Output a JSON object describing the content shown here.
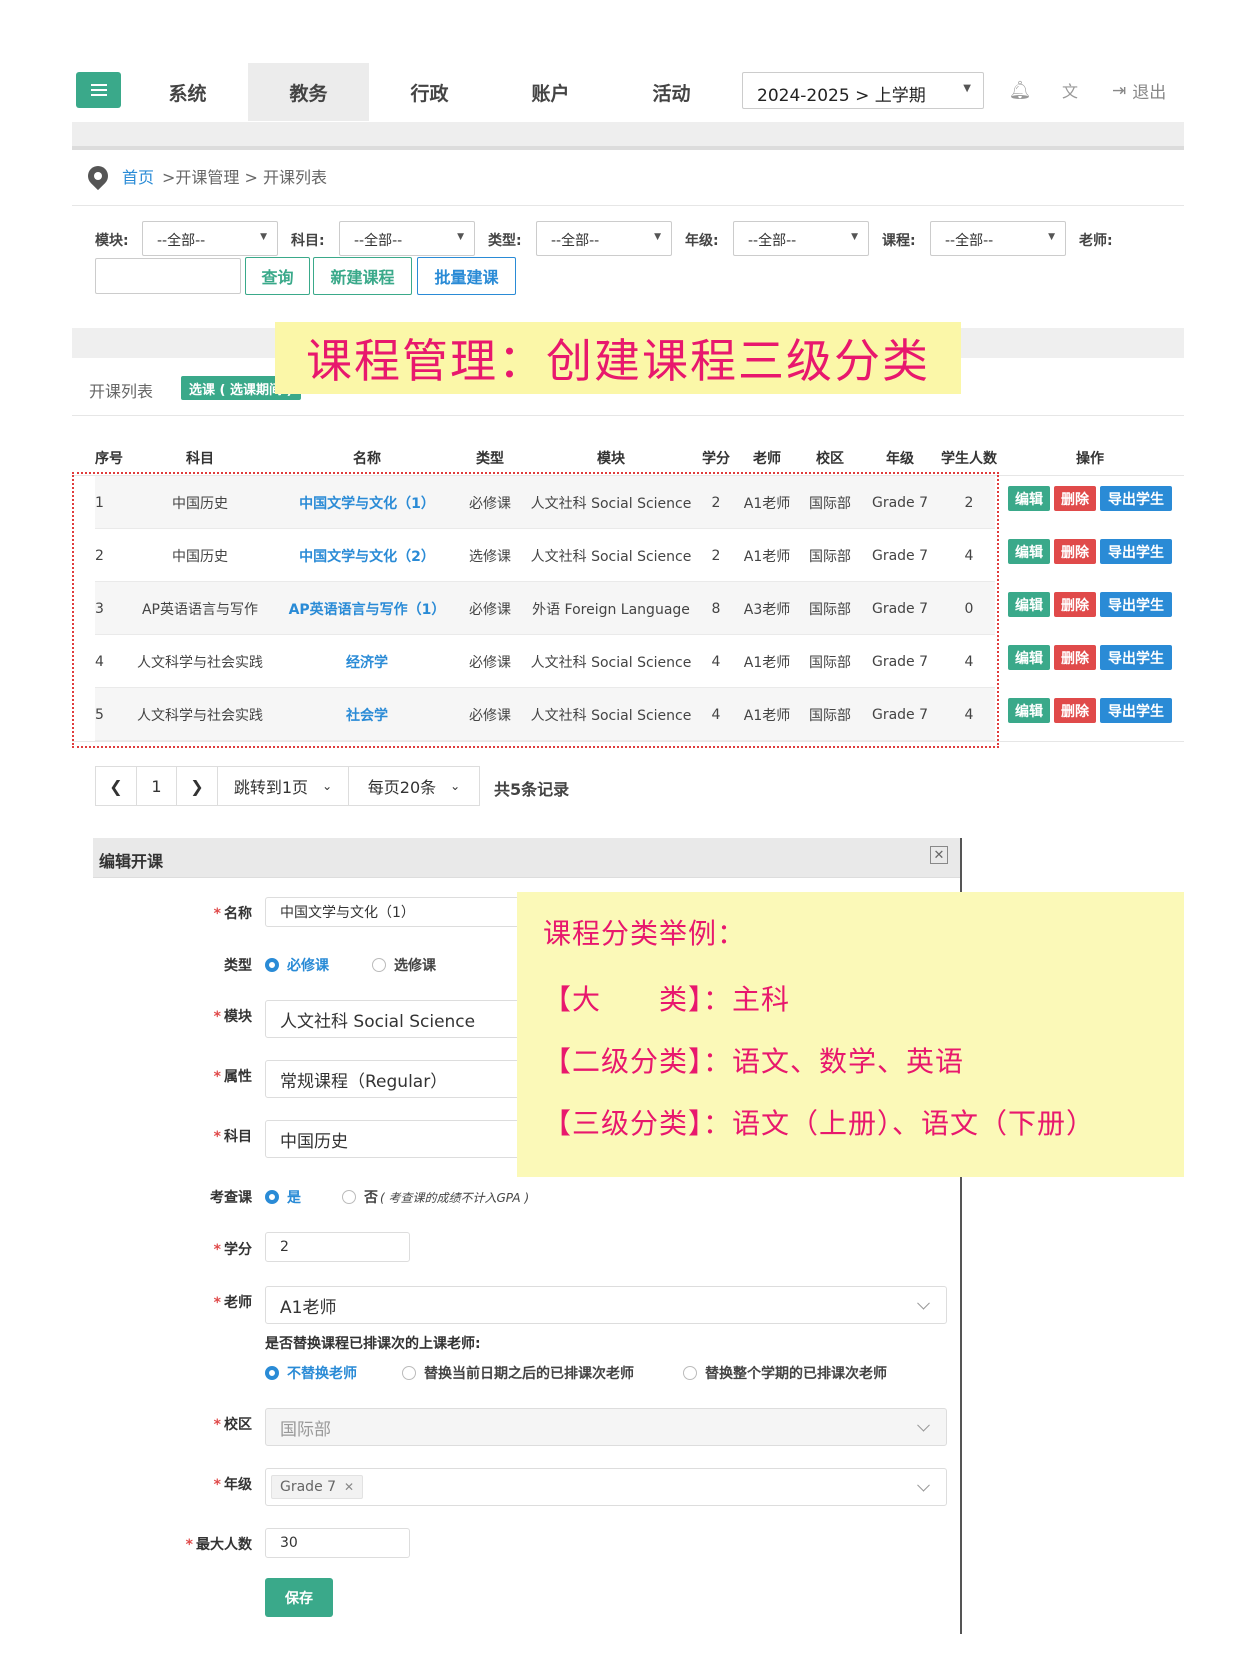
{
  "nav": {
    "tabs": [
      "系统",
      "教务",
      "行政",
      "账户",
      "活动"
    ],
    "active_tab": "教务",
    "term": "2024-2025 > 上学期",
    "logout": "退出"
  },
  "breadcrumb": {
    "home": "首页",
    "rest": ">开课管理 > 开课列表"
  },
  "filters": {
    "labels": [
      "模块:",
      "科目:",
      "类型:",
      "年级:",
      "课程:",
      "老师:"
    ],
    "all_option": "--全部--",
    "query": "查询",
    "new_course": "新建课程",
    "batch": "批量建课"
  },
  "banner": "课程管理：创建课程三级分类",
  "list": {
    "title": "开课列表",
    "tag": "选课 ( 选课期间 )"
  },
  "table": {
    "headers": [
      "序号",
      "科目",
      "名称",
      "类型",
      "模块",
      "学分",
      "老师",
      "校区",
      "年级",
      "学生人数",
      "操作"
    ],
    "rows": [
      [
        "1",
        "中国历史",
        "中国文学与文化（1）",
        "必修课",
        "人文社科 Social Science",
        "2",
        "A1老师",
        "国际部",
        "Grade 7",
        "2"
      ],
      [
        "2",
        "中国历史",
        "中国文学与文化（2）",
        "选修课",
        "人文社科 Social Science",
        "2",
        "A1老师",
        "国际部",
        "Grade 7",
        "4"
      ],
      [
        "3",
        "AP英语语言与写作",
        "AP英语语言与写作（1）",
        "必修课",
        "外语 Foreign Language",
        "8",
        "A3老师",
        "国际部",
        "Grade 7",
        "0"
      ],
      [
        "4",
        "人文科学与社会实践",
        "经济学",
        "必修课",
        "人文社科 Social Science",
        "4",
        "A1老师",
        "国际部",
        "Grade 7",
        "4"
      ],
      [
        "5",
        "人文科学与社会实践",
        "社会学",
        "必修课",
        "人文社科 Social Science",
        "4",
        "A1老师",
        "国际部",
        "Grade 7",
        "4"
      ]
    ],
    "ops": {
      "edit": "编辑",
      "delete": "删除",
      "export": "导出学生"
    }
  },
  "pagination": {
    "page": "1",
    "jump": "跳转到1页",
    "per_page": "每页20条",
    "total": "共5条记录"
  },
  "dialog": {
    "title": "编辑开课",
    "name_label": "名称",
    "name_value": "中国文学与文化（1）",
    "type_label": "类型",
    "type_opt1": "必修课",
    "type_opt2": "选修课",
    "module_label": "模块",
    "module_value": "人文社科 Social Science",
    "attr_label": "属性",
    "attr_value": "常规课程（Regular）",
    "subject_label": "科目",
    "subject_value": "中国历史",
    "exam_label": "考查课",
    "exam_yes": "是",
    "exam_no": "否",
    "exam_note": "( 考查课的成绩不计入GPA )",
    "credit_label": "学分",
    "credit_value": "2",
    "teacher_label": "老师",
    "teacher_value": "A1老师",
    "replace_q": "是否替换课程已排课次的上课老师:",
    "replace_opt1": "不替换老师",
    "replace_opt2": "替换当前日期之后的已排课次老师",
    "replace_opt3": "替换整个学期的已排课次老师",
    "campus_label": "校区",
    "campus_value": "国际部",
    "grade_label": "年级",
    "grade_value": "Grade 7",
    "max_label": "最大人数",
    "max_value": "30",
    "save": "保存"
  },
  "note": {
    "title": "课程分类举例：",
    "line1_key": "【大　　类】：",
    "line1_val": "主科",
    "line2_key": "【二级分类】：",
    "line2_val": "语文、数学、英语",
    "line3_key": "【三级分类】：",
    "line3_val": "语文（上册）、语文（下册）"
  }
}
